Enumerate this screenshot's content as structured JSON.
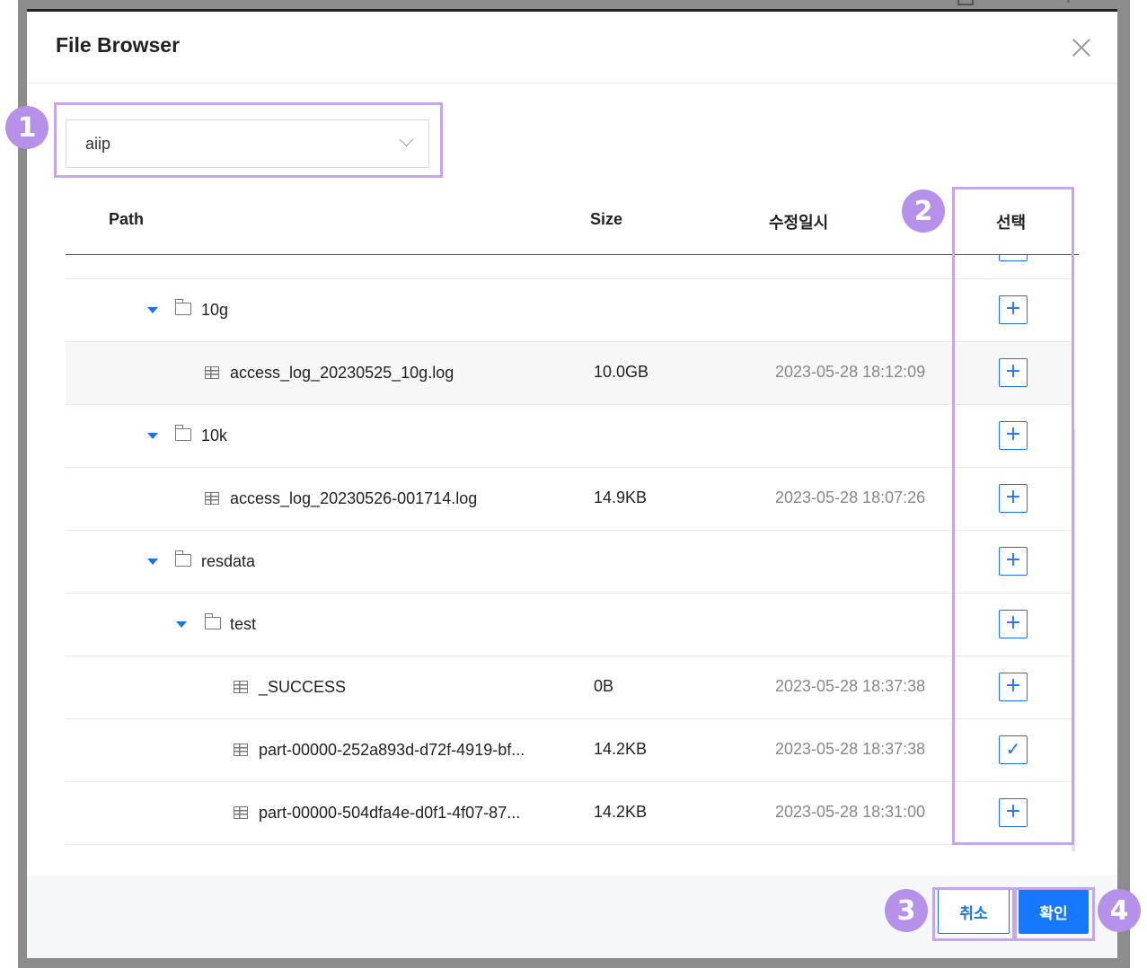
{
  "dialog": {
    "title": "File Browser",
    "close_icon": "close-icon"
  },
  "bucket_select": {
    "value": "aiip",
    "icon": "chevron-down-icon"
  },
  "table": {
    "columns": {
      "path": "Path",
      "size": "Size",
      "modified": "수정일시",
      "select": "선택"
    },
    "rows": [
      {
        "type": "folder",
        "name": "10g",
        "size": "",
        "modified": "",
        "selected": false
      },
      {
        "type": "file",
        "name": "access_log_20230525_10g.log",
        "size": "10.0GB",
        "modified": "2023-05-28 18:12:09",
        "selected": false
      },
      {
        "type": "folder",
        "name": "10k",
        "size": "",
        "modified": "",
        "selected": false
      },
      {
        "type": "file",
        "name": "access_log_20230526-001714.log",
        "size": "14.9KB",
        "modified": "2023-05-28 18:07:26",
        "selected": false
      },
      {
        "type": "folder",
        "name": "resdata",
        "size": "",
        "modified": "",
        "selected": false
      },
      {
        "type": "folder",
        "name": "test",
        "size": "",
        "modified": "",
        "selected": false
      },
      {
        "type": "file",
        "name": "_SUCCESS",
        "size": "0B",
        "modified": "2023-05-28 18:37:38",
        "selected": false
      },
      {
        "type": "file",
        "name": "part-00000-252a893d-d72f-4919-bf...",
        "size": "14.2KB",
        "modified": "2023-05-28 18:37:38",
        "selected": true
      },
      {
        "type": "file",
        "name": "part-00000-504dfa4e-d0f1-4f07-87...",
        "size": "14.2KB",
        "modified": "2023-05-28 18:31:00",
        "selected": false
      }
    ],
    "select_add_symbol": "+",
    "select_checked_symbol": "✓"
  },
  "footer": {
    "cancel_label": "취소",
    "ok_label": "확인"
  },
  "annotations": {
    "badge_1": "1",
    "badge_2": "2",
    "badge_3": "3",
    "badge_4": "4"
  },
  "colors": {
    "accent": "#1677ff",
    "annotation": "#b591ea",
    "annotation_border": "#c4a5ee"
  }
}
